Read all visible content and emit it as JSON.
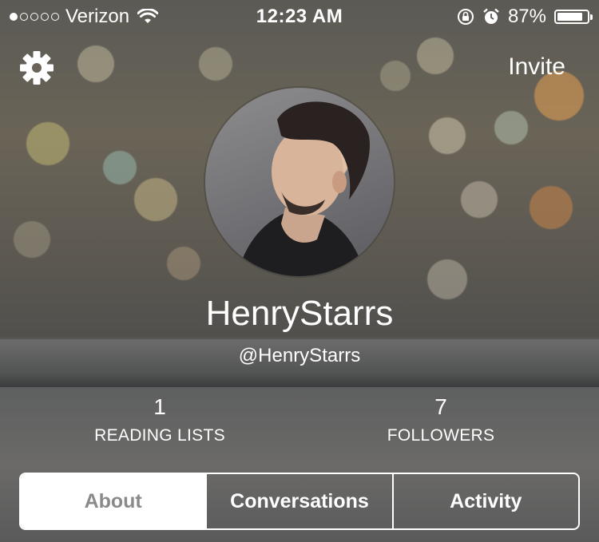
{
  "status_bar": {
    "carrier": "Verizon",
    "time": "12:23 AM",
    "battery_percent": "87%",
    "battery_level": 0.87,
    "signal_bars_filled": 1,
    "signal_bars_total": 5
  },
  "header": {
    "settings_icon": "gear-icon",
    "invite_label": "Invite"
  },
  "profile": {
    "display_name": "HenryStarrs",
    "handle": "@HenryStarrs"
  },
  "stats": {
    "reading_lists": {
      "count": "1",
      "label": "READING LISTS"
    },
    "followers": {
      "count": "7",
      "label": "FOLLOWERS"
    }
  },
  "tabs": [
    {
      "label": "About",
      "active": true
    },
    {
      "label": "Conversations",
      "active": false
    },
    {
      "label": "Activity",
      "active": false
    }
  ],
  "colors": {
    "active_tab_bg": "#ffffff",
    "active_tab_text": "#8a8a8a",
    "text": "#ffffff"
  }
}
